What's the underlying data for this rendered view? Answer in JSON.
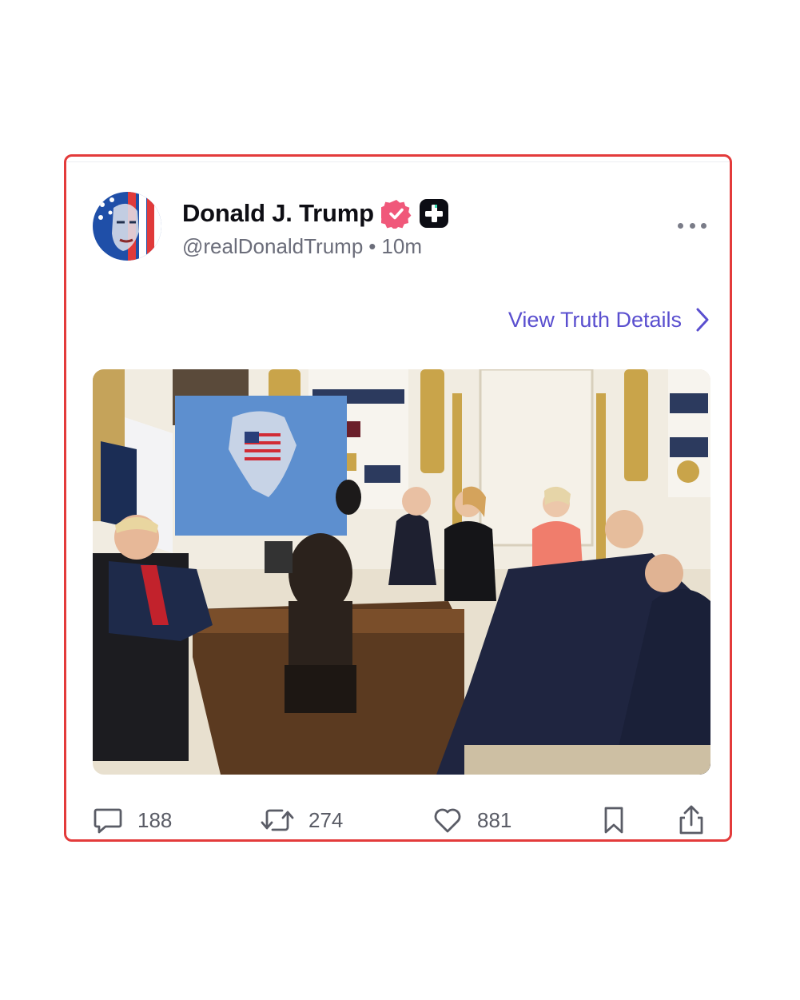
{
  "post": {
    "author": {
      "display_name": "Donald J. Trump",
      "handle": "@realDonaldTrump",
      "age": "10m"
    },
    "view_details_label": "View Truth Details",
    "actions": {
      "reply_count": "188",
      "retruth_count": "274",
      "like_count": "881"
    }
  },
  "colors": {
    "accent": "#5a4fcf",
    "verified": "#f0587a",
    "card_border": "#e33b3b",
    "meta_text": "#6b6d7a"
  },
  "icons": {
    "verified": "verified-badge-icon",
    "plus": "truth-plus-icon",
    "more": "more-horizontal-icon",
    "view_details": "chevron-right-icon",
    "reply": "speech-bubble-icon",
    "retruth": "retruth-icon",
    "like": "heart-icon",
    "bookmark": "bookmark-icon",
    "share": "share-icon"
  }
}
